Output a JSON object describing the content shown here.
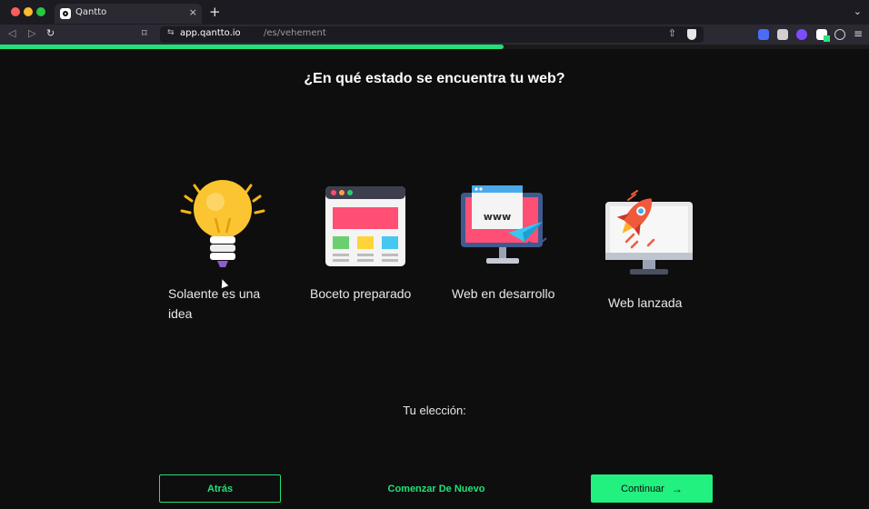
{
  "browser": {
    "tab_title": "Qantto",
    "tab_close": "×",
    "new_tab": "+",
    "tabs_menu": "⌄",
    "url_host": "app.qantto.io",
    "url_path": "/es/vehement",
    "nav_back": "◁",
    "nav_forward": "▷",
    "nav_reload": "↻",
    "bookmark": "⌑",
    "url_info": "⇆",
    "share": "⇧",
    "hamburger": "≡"
  },
  "progress": {
    "value": 0.58,
    "color": "#22e07a"
  },
  "question": "¿En qué estado se encuentra tu web?",
  "options": [
    {
      "label": "Solaente es una idea",
      "icon": "lightbulb-icon"
    },
    {
      "label": "Boceto preparado",
      "icon": "wireframe-window-icon"
    },
    {
      "label": "Web en desarrollo",
      "icon": "www-monitor-icon"
    },
    {
      "label": "Web lanzada",
      "icon": "rocket-monitor-icon"
    }
  ],
  "choice_label": "Tu elección:",
  "buttons": {
    "back": "Atrás",
    "restart": "Comenzar De Nuevo",
    "continue": "Continuar",
    "continue_arrow": "→"
  },
  "colors": {
    "accent": "#22e07a",
    "background": "#0e0e0e"
  }
}
